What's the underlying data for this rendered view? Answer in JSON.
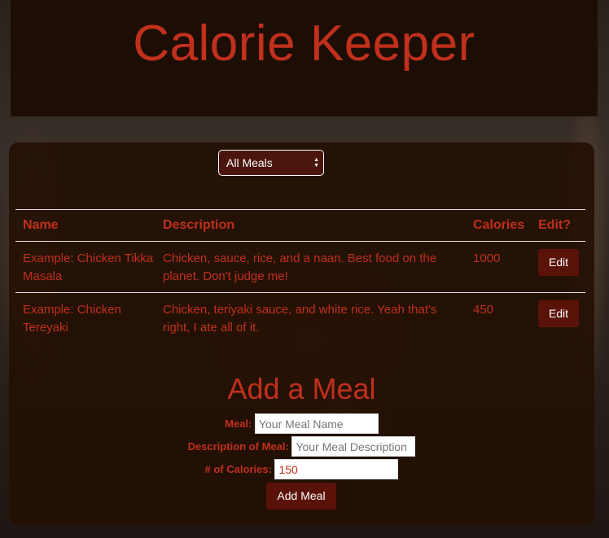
{
  "app": {
    "title": "Calorie Keeper"
  },
  "filter": {
    "selected": "All Meals"
  },
  "table": {
    "headers": {
      "name": "Name",
      "description": "Description",
      "calories": "Calories",
      "edit": "Edit?"
    },
    "rows": [
      {
        "name": "Example: Chicken Tikka Masala",
        "description": "Chicken, sauce, rice, and a naan. Best food on the planet. Don't judge me!",
        "calories": "1000",
        "edit_label": "Edit"
      },
      {
        "name": "Example: Chicken Tereyaki",
        "description": "Chicken, teriyaki sauce, and white rice. Yeah that's right, I ate all of it.",
        "calories": "450",
        "edit_label": "Edit"
      }
    ]
  },
  "add_form": {
    "title": "Add a Meal",
    "meal_label": "Meal:",
    "meal_placeholder": "Your Meal Name",
    "description_label": "Description of Meal:",
    "description_placeholder": "Your Meal Description",
    "calories_label": "# of Calories:",
    "calories_value": "150",
    "submit_label": "Add Meal"
  },
  "colors": {
    "accent": "#c0301c",
    "button": "#5a1208",
    "panel": "#230f03"
  }
}
